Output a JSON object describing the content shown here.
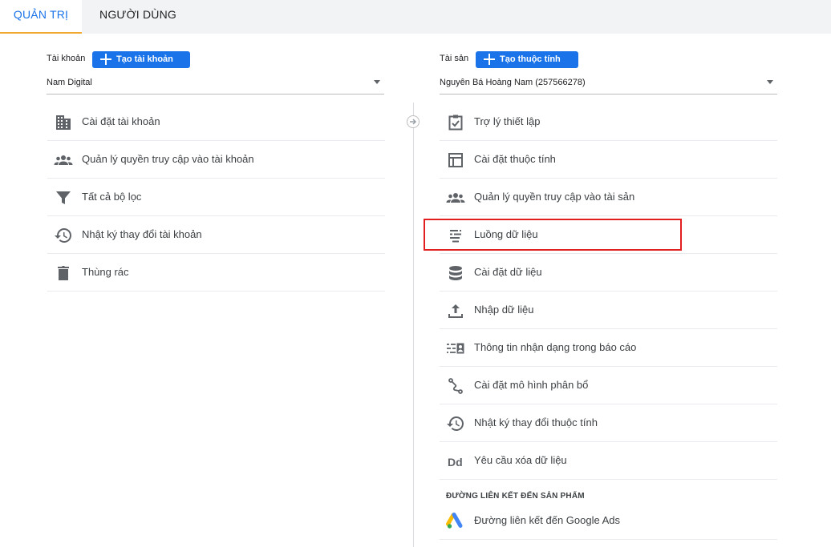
{
  "tabs": [
    {
      "label": "QUẢN TRỊ",
      "active": true
    },
    {
      "label": "NGƯỜI DÙNG",
      "active": false
    }
  ],
  "account": {
    "label": "Tài khoản",
    "create_label": "Tạo tài khoản",
    "selected": "Nam Digital",
    "items": [
      {
        "label": "Cài đặt tài khoản",
        "icon": "building-icon"
      },
      {
        "label": "Quản lý quyền truy cập vào tài khoản",
        "icon": "people-icon"
      },
      {
        "label": "Tất cả bộ lọc",
        "icon": "filter-icon"
      },
      {
        "label": "Nhật ký thay đổi tài khoản",
        "icon": "history-icon"
      },
      {
        "label": "Thùng rác",
        "icon": "trash-icon"
      }
    ]
  },
  "property": {
    "label": "Tài sản",
    "create_label": "Tạo thuộc tính",
    "selected": "Nguyên Bá Hoàng Nam (257566278)",
    "items": [
      {
        "label": "Trợ lý thiết lập",
        "icon": "clipboard-check-icon"
      },
      {
        "label": "Cài đặt thuộc tính",
        "icon": "layout-icon"
      },
      {
        "label": "Quản lý quyền truy cập vào tài sản",
        "icon": "people-icon"
      },
      {
        "label": "Luồng dữ liệu",
        "icon": "data-streams-icon"
      },
      {
        "label": "Cài đặt dữ liệu",
        "icon": "database-icon"
      },
      {
        "label": "Nhập dữ liệu",
        "icon": "upload-icon"
      },
      {
        "label": "Thông tin nhận dạng trong báo cáo",
        "icon": "reporting-identity-icon"
      },
      {
        "label": "Cài đặt mô hình phân bổ",
        "icon": "attribution-icon"
      },
      {
        "label": "Nhật ký thay đổi thuộc tính",
        "icon": "history-icon"
      },
      {
        "label": "Yêu cầu xóa dữ liệu",
        "icon": "dd-icon"
      }
    ],
    "section_title": "ĐƯỜNG LIÊN KẾT ĐẾN SẢN PHẨM",
    "links": [
      {
        "label": "Đường liên kết đến Google Ads",
        "icon": "google-ads-icon"
      }
    ]
  },
  "colors": {
    "accent": "#1a73e8",
    "tab_underline": "#f0a830",
    "highlight": "#e21e1e",
    "icon": "#5f6368"
  }
}
